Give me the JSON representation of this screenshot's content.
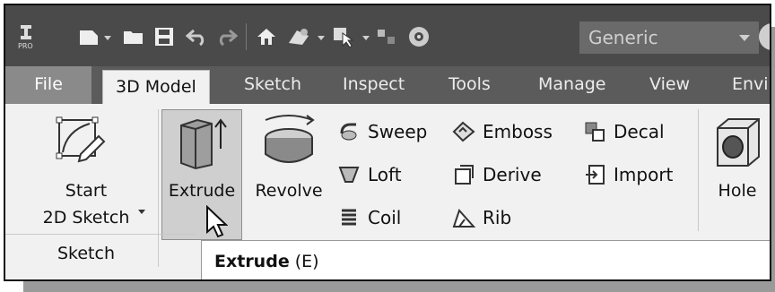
{
  "qat": {
    "appearance_value": "Generic",
    "icons": [
      "pro-logo-icon",
      "new-file-icon",
      "open-folder-icon",
      "save-icon",
      "undo-icon",
      "redo-icon",
      "home-icon",
      "material-icon",
      "select-icon",
      "components-icon",
      "appearance-icon"
    ]
  },
  "tabs": [
    {
      "label": "File"
    },
    {
      "label": "3D Model"
    },
    {
      "label": "Sketch"
    },
    {
      "label": "Inspect"
    },
    {
      "label": "Tools"
    },
    {
      "label": "Manage"
    },
    {
      "label": "View"
    },
    {
      "label": "Envir"
    }
  ],
  "ribbon": {
    "start_sketch_line1": "Start",
    "start_sketch_line2": "2D Sketch",
    "sketch_group": "Sketch",
    "extrude": "Extrude",
    "revolve": "Revolve",
    "sweep": "Sweep",
    "loft": "Loft",
    "coil": "Coil",
    "emboss": "Emboss",
    "derive": "Derive",
    "rib": "Rib",
    "decal": "Decal",
    "import": "Import",
    "hole": "Hole"
  },
  "tooltip": {
    "title": "Extrude",
    "shortcut": "(E)"
  }
}
